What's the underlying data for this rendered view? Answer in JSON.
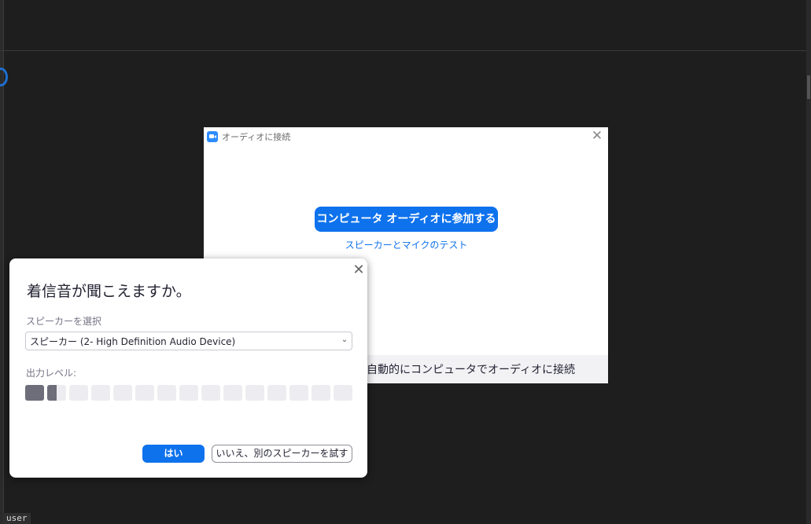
{
  "audio_dialog": {
    "title": "オーディオに接続",
    "join_button_label": "コンピュータ オーディオに参加する",
    "test_link_label": "スピーカーとマイクのテスト",
    "auto_connect_label": "自動的にコンピュータでオーディオに接続",
    "close_symbol": "✕"
  },
  "speaker_dialog": {
    "title": "着信音が聞こえますか。",
    "select_label": "スピーカーを選択",
    "selected_speaker": "スピーカー (2- High Definition Audio Device)",
    "chevron_symbol": "⌄",
    "output_level_label": "出力レベル:",
    "output_level": {
      "segments_total": 15,
      "segments_filled": 1.5
    },
    "yes_label": "はい",
    "no_label": "いいえ、別のスピーカーを試す",
    "close_symbol": "✕"
  },
  "taskbar": {
    "user_label": "user"
  },
  "colors": {
    "accent": "#0e72ed",
    "app_icon": "#2d8cff",
    "background": "#1e1e1e",
    "meter_filled": "#6e6e7a",
    "meter_empty": "#ededf1"
  }
}
